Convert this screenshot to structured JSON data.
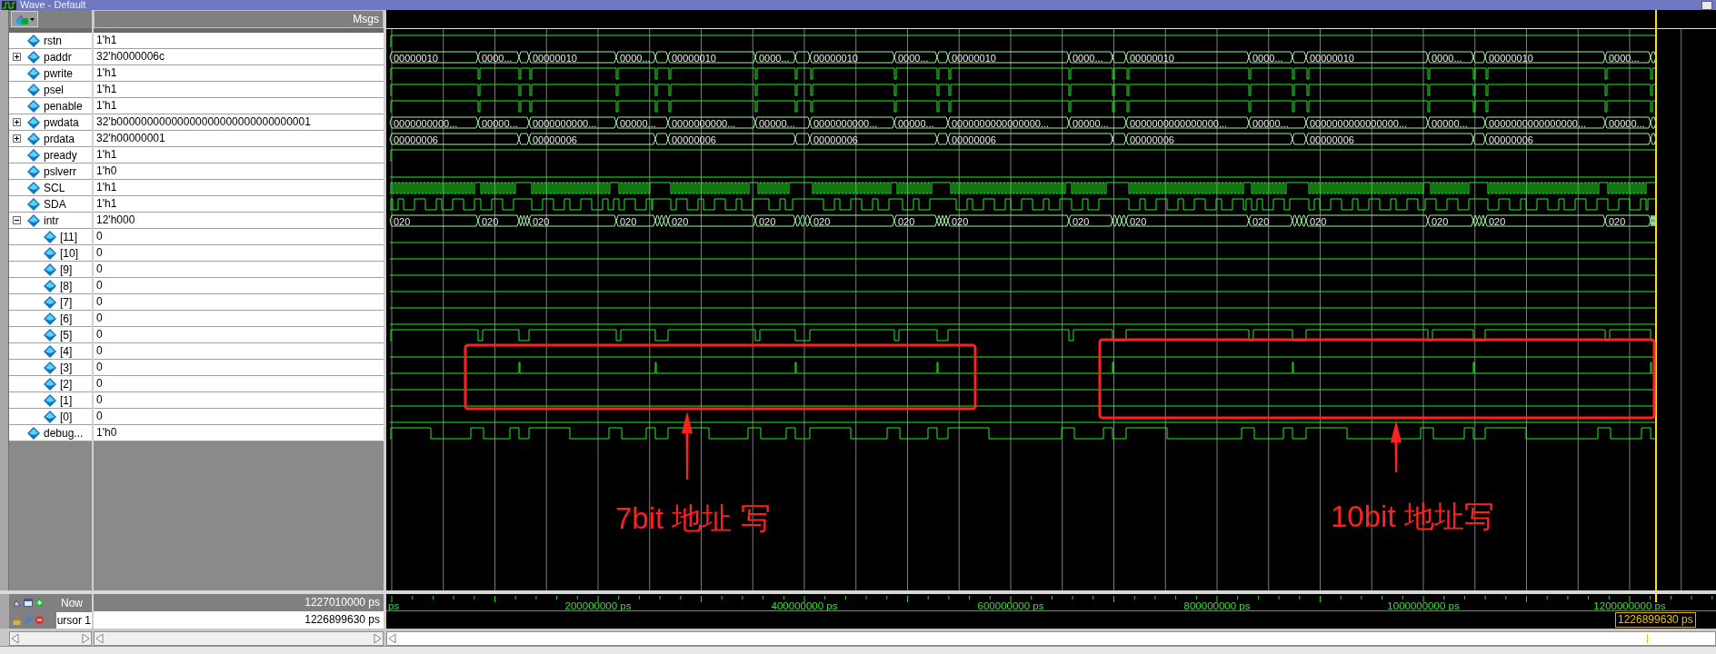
{
  "window": {
    "title": "Wave - Default"
  },
  "values_header": "Msgs",
  "signals": [
    {
      "name": "rstn",
      "value": "1'h1",
      "kind": "high"
    },
    {
      "name": "paddr",
      "value": "32'h0000006c",
      "kind": "addr_bus",
      "expanded": false,
      "segments": [
        "00000010",
        "0000...",
        "00000010",
        "0000...",
        "00000010",
        "0000...",
        "00000010",
        "0000...",
        "00000010",
        "0000...",
        "00000010",
        "0000...",
        "00000010",
        "0000...",
        "00000010",
        "0000..."
      ]
    },
    {
      "name": "pwrite",
      "value": "1'h1",
      "kind": "strobe"
    },
    {
      "name": "psel",
      "value": "1'h1",
      "kind": "strobe"
    },
    {
      "name": "penable",
      "value": "1'h1",
      "kind": "strobe"
    },
    {
      "name": "pwdata",
      "value": "32'b00000000000000000000000000000001",
      "kind": "wdata_bus",
      "expanded": false,
      "segments": [
        "0000000000...",
        "00000...",
        "0000000000...",
        "00000...",
        "0000000000...",
        "00000...",
        "0000000000...",
        "00000...",
        "0000000000000000...",
        "00000...",
        "0000000000000000...",
        "00000...",
        "0000000000000000...",
        "00000...",
        "0000000000000000...",
        "00000..."
      ]
    },
    {
      "name": "prdata",
      "value": "32'h00000001",
      "kind": "rdata_bus",
      "expanded": false,
      "segments": [
        "00000006",
        "00000006",
        "00000006",
        "00000006",
        "00000006",
        "00000006",
        "00000006",
        "00000006"
      ]
    },
    {
      "name": "pready",
      "value": "1'h1",
      "kind": "high"
    },
    {
      "name": "pslverr",
      "value": "1'h0",
      "kind": "low"
    },
    {
      "name": "SCL",
      "value": "1'h1",
      "kind": "scl"
    },
    {
      "name": "SDA",
      "value": "1'h1",
      "kind": "sda"
    },
    {
      "name": "intr",
      "value": "12'h000",
      "kind": "intr_bus",
      "expanded": true,
      "segments": [
        "020",
        "020",
        "020",
        "020",
        "020",
        "020",
        "020",
        "020",
        "020",
        "020",
        "020",
        "020",
        "020",
        "020",
        "020",
        "020"
      ],
      "children": [
        {
          "name": "[11]",
          "value": "0",
          "kind": "low"
        },
        {
          "name": "[10]",
          "value": "0",
          "kind": "low"
        },
        {
          "name": "[9]",
          "value": "0",
          "kind": "low"
        },
        {
          "name": "[8]",
          "value": "0",
          "kind": "low"
        },
        {
          "name": "[7]",
          "value": "0",
          "kind": "low"
        },
        {
          "name": "[6]",
          "value": "0",
          "kind": "low"
        },
        {
          "name": "[5]",
          "value": "0",
          "kind": "pulse"
        },
        {
          "name": "[4]",
          "value": "0",
          "kind": "low"
        },
        {
          "name": "[3]",
          "value": "0",
          "kind": "spike"
        },
        {
          "name": "[2]",
          "value": "0",
          "kind": "low"
        },
        {
          "name": "[1]",
          "value": "0",
          "kind": "low"
        },
        {
          "name": "[0]",
          "value": "0",
          "kind": "low"
        }
      ]
    },
    {
      "name": "debug...",
      "value": "1'h0",
      "kind": "toggle"
    }
  ],
  "now": {
    "label": "Now",
    "value": "1227010000 ps"
  },
  "cursor": {
    "label": "ursor 1",
    "value": "1226899630 ps",
    "flag": "1226899630 ps"
  },
  "time_axis": {
    "labels": [
      "ps",
      "200000000 ps",
      "400000000 ps",
      "600000000 ps",
      "800000000 ps",
      "1000000000 ps",
      "1200000000 ps"
    ]
  },
  "annotations": [
    {
      "text": "7bit 地址 写"
    },
    {
      "text": "10bit 地址写"
    }
  ]
}
